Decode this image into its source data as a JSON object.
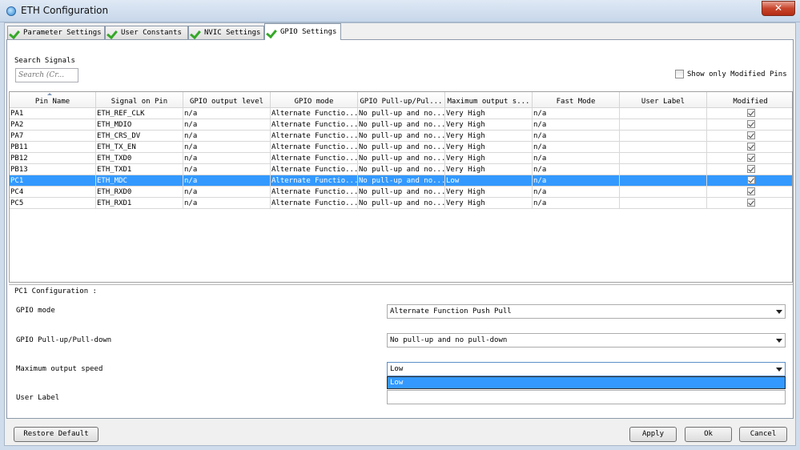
{
  "window": {
    "title": "ETH Configuration",
    "close_glyph": "✕"
  },
  "tabs": [
    {
      "label": "Parameter Settings",
      "icon": "check-icon"
    },
    {
      "label": "User Constants",
      "icon": "check-icon"
    },
    {
      "label": "NVIC Settings",
      "icon": "check-icon"
    },
    {
      "label": "GPIO Settings",
      "icon": "check-icon",
      "active": true
    }
  ],
  "search": {
    "label": "Search Signals",
    "placeholder": "Search (Cr..."
  },
  "show_modified": {
    "label": "Show only Modified Pins",
    "checked": false
  },
  "table": {
    "columns": [
      "Pin Name",
      "Signal on Pin",
      "GPIO output level",
      "GPIO mode",
      "GPIO Pull-up/Pul...",
      "Maximum output s...",
      "Fast Mode",
      "User Label",
      "Modified"
    ],
    "rows": [
      {
        "pin": "PA1",
        "signal": "ETH_REF_CLK",
        "level": "n/a",
        "mode": "Alternate Functio...",
        "pull": "No pull-up and no...",
        "speed": "Very High",
        "fast": "n/a",
        "label": "",
        "modified": true
      },
      {
        "pin": "PA2",
        "signal": "ETH_MDIO",
        "level": "n/a",
        "mode": "Alternate Functio...",
        "pull": "No pull-up and no...",
        "speed": "Very High",
        "fast": "n/a",
        "label": "",
        "modified": true
      },
      {
        "pin": "PA7",
        "signal": "ETH_CRS_DV",
        "level": "n/a",
        "mode": "Alternate Functio...",
        "pull": "No pull-up and no...",
        "speed": "Very High",
        "fast": "n/a",
        "label": "",
        "modified": true
      },
      {
        "pin": "PB11",
        "signal": "ETH_TX_EN",
        "level": "n/a",
        "mode": "Alternate Functio...",
        "pull": "No pull-up and no...",
        "speed": "Very High",
        "fast": "n/a",
        "label": "",
        "modified": true
      },
      {
        "pin": "PB12",
        "signal": "ETH_TXD0",
        "level": "n/a",
        "mode": "Alternate Functio...",
        "pull": "No pull-up and no...",
        "speed": "Very High",
        "fast": "n/a",
        "label": "",
        "modified": true
      },
      {
        "pin": "PB13",
        "signal": "ETH_TXD1",
        "level": "n/a",
        "mode": "Alternate Functio...",
        "pull": "No pull-up and no...",
        "speed": "Very High",
        "fast": "n/a",
        "label": "",
        "modified": true
      },
      {
        "pin": "PC1",
        "signal": "ETH_MDC",
        "level": "n/a",
        "mode": "Alternate Functio...",
        "pull": "No pull-up and no...",
        "speed": "Low",
        "fast": "n/a",
        "label": "",
        "modified": true,
        "selected": true
      },
      {
        "pin": "PC4",
        "signal": "ETH_RXD0",
        "level": "n/a",
        "mode": "Alternate Functio...",
        "pull": "No pull-up and no...",
        "speed": "Very High",
        "fast": "n/a",
        "label": "",
        "modified": true
      },
      {
        "pin": "PC5",
        "signal": "ETH_RXD1",
        "level": "n/a",
        "mode": "Alternate Functio...",
        "pull": "No pull-up and no...",
        "speed": "Very High",
        "fast": "n/a",
        "label": "",
        "modified": true
      }
    ]
  },
  "config": {
    "title": "PC1 Configuration :",
    "gpio_mode": {
      "label": "GPIO mode",
      "value": "Alternate Function Push Pull"
    },
    "pull": {
      "label": "GPIO Pull-up/Pull-down",
      "value": "No pull-up and no pull-down"
    },
    "speed": {
      "label": "Maximum output speed",
      "value": "Low",
      "dropdown_option": "Low"
    },
    "user_label": {
      "label": "User Label",
      "value": ""
    }
  },
  "buttons": {
    "restore": "Restore Default",
    "apply": "Apply",
    "ok": "Ok",
    "cancel": "Cancel"
  },
  "colors": {
    "selection": "#3399ff",
    "check_green": "#35a828",
    "close_red": "#c8452c"
  }
}
